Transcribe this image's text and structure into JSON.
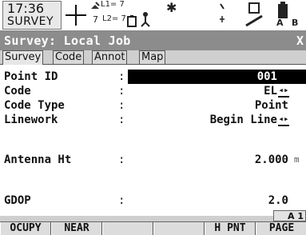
{
  "status": {
    "time": "17:36",
    "mode": "SURVEY",
    "l1": "L1= 7",
    "l2": "L2= 7",
    "sat7": "7",
    "indicator": "A 1"
  },
  "window": {
    "title": "Survey: Local Job",
    "close": "X"
  },
  "tabs": [
    "Survey",
    "Code",
    "Annot",
    "Map"
  ],
  "fields": [
    {
      "label": "Point ID",
      "value": "001"
    },
    {
      "label": "Code",
      "value": "EL"
    },
    {
      "label": "Code Type",
      "value": "Point"
    },
    {
      "label": "Linework",
      "value": "Begin Line"
    },
    {
      "label": "Antenna Ht",
      "value": "2.000",
      "unit": "m"
    },
    {
      "label": "GDOP",
      "value": "2.0"
    }
  ],
  "softkeys": [
    "OCUPY",
    "NEAR",
    "",
    "",
    "H PNT",
    "PAGE"
  ],
  "icons": {
    "close": "close-icon",
    "dropdown": "dropdown-arrow-icon"
  }
}
